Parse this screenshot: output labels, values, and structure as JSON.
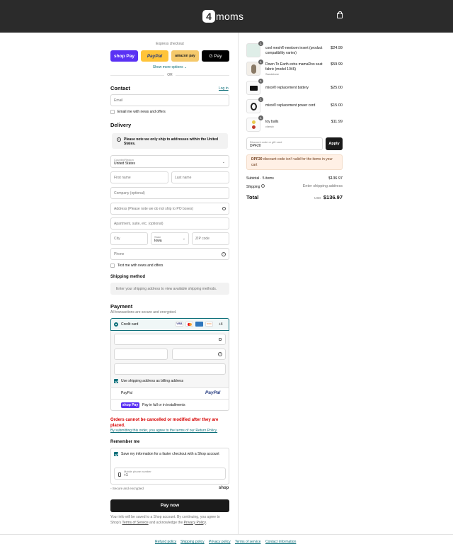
{
  "header": {
    "logo_mark": "4",
    "logo_text": "moms"
  },
  "express": {
    "title": "Express checkout",
    "shop": "shop Pay",
    "paypal": "PayPal",
    "amazon": "amazon pay",
    "gpay": "G Pay",
    "more": "Show more options",
    "or": "OR"
  },
  "contact": {
    "title": "Contact",
    "login": "Log in",
    "email_placeholder": "Email",
    "news": "Email me with news and offers"
  },
  "delivery": {
    "title": "Delivery",
    "notice": "Please note we only ship to addresses within the United States.",
    "country_label": "Country/Region",
    "country": "United States",
    "first": "First name",
    "last": "Last name",
    "company": "Company (optional)",
    "address": "Address (Please note we do not ship to PO boxes)",
    "apt": "Apartment, suite, etc. (optional)",
    "city": "City",
    "state_label": "State",
    "state": "Iowa",
    "zip": "ZIP code",
    "phone": "Phone",
    "text_news": "Text me with news and offers"
  },
  "shipping_method": {
    "title": "Shipping method",
    "placeholder": "Enter your shipping address to view available shipping methods."
  },
  "payment": {
    "title": "Payment",
    "subtitle": "All transactions are secure and encrypted.",
    "credit": "Credit card",
    "more_cards": "+4",
    "billing": "Use shipping address as billing address",
    "paypal": "PayPal",
    "shoppay_text": "Pay in full or in installments",
    "shoppay_logo": "shop Pay",
    "card_brands": [
      "VISA",
      "MC",
      "AMEX",
      "DISC"
    ]
  },
  "warning": {
    "text": "Orders cannot be cancelled or modified after they are placed.",
    "terms": "By submitting this order, you agree to the terms of our Return Policy."
  },
  "remember": {
    "title": "Remember me",
    "save": "Save my information for a faster checkout with a Shop account",
    "mobile_label": "Mobile phone number",
    "mobile_value": "+1",
    "secure": "Secure and encrypted",
    "shop": "shop"
  },
  "pay_now": "Pay now",
  "shop_note": {
    "before": "Your info will be saved to a Shop account. By continuing, you agree to Shop's ",
    "terms": "Terms of Service",
    "mid": " and acknowledge the ",
    "privacy": "Privacy Policy",
    "end": "."
  },
  "cart": {
    "items": [
      {
        "name": "cool mesh® newborn insert (product compatibility varies)",
        "sub": "",
        "qty": "1",
        "price": "$24.99"
      },
      {
        "name": "Down To Earth extra mamaRoo seat fabric (model 1046)",
        "sub": "Sandstone",
        "qty": "1",
        "price": "$59.99"
      },
      {
        "name": "mioxi® replacement battery",
        "sub": "",
        "qty": "1",
        "price": "$25.00"
      },
      {
        "name": "mioxi® replacement power cord",
        "sub": "",
        "qty": "1",
        "price": "$15.00"
      },
      {
        "name": "toy balls",
        "sub": "classic",
        "qty": "1",
        "price": "$11.99"
      }
    ],
    "discount_label": "Discount code or gift card",
    "discount_value": "DPF20",
    "apply": "Apply",
    "error_code": "DPF20",
    "error_text": " discount code isn't valid for the items in your cart",
    "subtotal_label": "Subtotal · 5 items",
    "subtotal": "$136.97",
    "shipping_label": "Shipping",
    "shipping_value": "Enter shipping address",
    "total_label": "Total",
    "currency": "USD",
    "total": "$136.97"
  },
  "footer": {
    "refund": "Refund policy",
    "shipping": "Shipping policy",
    "privacy": "Privacy policy",
    "terms": "Terms of service",
    "contact": "Contact information"
  },
  "colors": {
    "accent": "#0b6e79",
    "shoppay": "#5a31f4",
    "paypal_bg": "#ffc439",
    "amazon_bg": "#f5c96b",
    "error": "#d70000"
  }
}
